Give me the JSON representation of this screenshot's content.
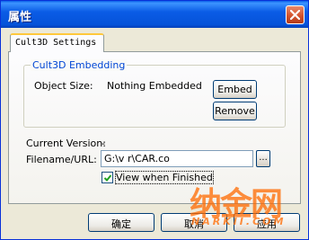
{
  "window": {
    "title": "属性",
    "close_icon": "close-x-icon"
  },
  "tab": {
    "label": "Cult3D Settings"
  },
  "embedding": {
    "legend": "Cult3D Embedding",
    "object_size_label": "Object Size:",
    "object_size_value": "Nothing Embedded",
    "embed_label": "Embed",
    "remove_label": "Remove"
  },
  "info": {
    "version_label": "Current Version:",
    "version_value": "-",
    "filename_label": "Filename/URL:",
    "filename_value": "G:\\v  r\\CAR.co",
    "browse_label": "...",
    "view_when_finished_label": "View when Finished",
    "view_when_finished_checked": true
  },
  "footer": {
    "ok_label": "确定",
    "cancel_label": "取消",
    "apply_label": "应用"
  },
  "watermark": {
    "text": "纳金网",
    "url": "NARKII.COM"
  },
  "colors": {
    "titlebar": "#0553d9",
    "accent_tab": "#ffc83c",
    "legend": "#0046d5",
    "watermark": "#ff6a00"
  }
}
